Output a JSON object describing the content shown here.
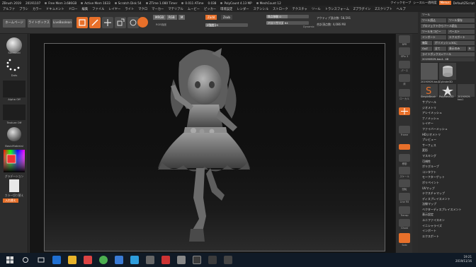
{
  "titlebar": {
    "app": "ZBrush 2019",
    "stats": [
      "20191107",
      "Free Mem 3.686GB",
      "Active Mem 1633",
      "Scratch Disk 54",
      "ZTime 1.080 Timer",
      "0.011 ATime",
      "0.038",
      "PolyCount 4.13 MP",
      "MeshCount 12"
    ],
    "quicksave": "クイックセーブ",
    "see_through": "シースルー透明度",
    "menus_btn": "Menus",
    "script": "DefaultZScript"
  },
  "menubar": [
    "アルファ",
    "ブラシ",
    "カラー",
    "ドキュメント",
    "ドロー",
    "編集",
    "ファイル",
    "レイヤー",
    "ライト",
    "マクロ",
    "マーカー",
    "マテリアル",
    "ムービー",
    "ピッカー",
    "環境設定",
    "レンダー",
    "ステンシル",
    "ストローク",
    "テクスチャ",
    "ツール",
    "トランスフォーム",
    "Zプラグイン",
    "Zスクリプト",
    "ヘルプ"
  ],
  "shelf": {
    "home": "ホームページ",
    "lightbox": "ライトボックス",
    "livebool": "LiveBoolean",
    "tools": [
      "エディット",
      "ドロー",
      "移動",
      "スケール",
      "回転"
    ],
    "mrgb": "MRGB",
    "rgb": "RGB",
    "m": "M",
    "zadd": "Zadd",
    "zsub": "Zsub",
    "rgb_intensity": "RGB強度",
    "z_intensity": "Z強度 25",
    "focal_shift": "焦点移動 0",
    "draw_size": "ドローサイズ 64",
    "dynamic": "Dynamic",
    "active_points": "アクティブ頂点数: 58,591",
    "total_points": "合計頂点数: 4,086 Mil"
  },
  "leftpanel": {
    "brush": "Standard",
    "stroke": "Dots",
    "alpha": "Alpha Off",
    "texture": "Texture Off",
    "material": "BasicMaterial",
    "gradient": "グラデーション",
    "switch_color": "カラー切り替え",
    "swatch": "入れ替え"
  },
  "rtoolbar": [
    "BPR",
    "SPix 3",
    "パース",
    "床",
    "ローカル",
    "Frame",
    "移動",
    "スケール",
    "回転",
    "Line Fill",
    "Transp",
    "Ghost",
    "Solo"
  ],
  "rightpanel": {
    "header": "ツール",
    "btns": [
      "ツール読込",
      "ツール保存",
      "プロジェクトからツール読込",
      "ツールをコピー",
      "ペースト",
      "インポート",
      "エクスポート",
      "複製",
      "ポリメッシュ3Dに",
      "GoZ",
      "全て",
      "表示のみ",
      "R"
    ],
    "lightbox_tool": "ライトボックス>ツール",
    "current": "20190929-kou1. 48",
    "thumbs": [
      "20190929-kou1",
      "Cylinder3D",
      "PolyMesh3D",
      "SimpleBrush",
      "20190929-kou1"
    ],
    "subtools": [
      "サブツール",
      "ジオメトリ",
      "アレイメッシュ",
      "ナノメッシュ",
      "レイヤー",
      "ファイバーメッシュ",
      "HDジオメトリ",
      "プレビュー",
      "サーフェス",
      "変形",
      "マスキング",
      "可視性",
      "ポリグループ",
      "コンタクト",
      "モーフターゲット",
      "ポリペイント",
      "UVマップ",
      "テクスチャマップ",
      "ディスプレイスメント",
      "法線マップ",
      "ベクターディスプレイスメント",
      "表示設定",
      "ユニファイスキン",
      "イニシャライズ",
      "インポート",
      "エクスポート"
    ]
  },
  "taskbar": {
    "time": "19:21",
    "date": "2019/11/16"
  },
  "colors": {
    "accent": "#e8702a",
    "bg": "#2b2b2b",
    "canvas": "#111111"
  }
}
